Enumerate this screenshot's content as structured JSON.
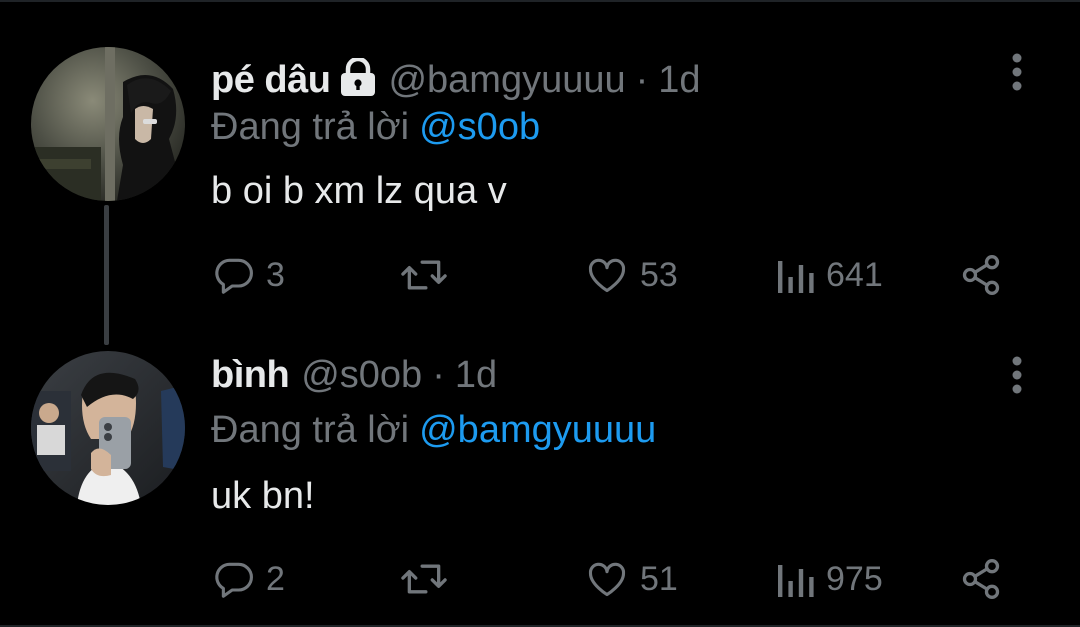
{
  "tweets": [
    {
      "display_name": "pé dâu",
      "protected": true,
      "handle": "@bamgyuuuu",
      "separator": "·",
      "time": "1d",
      "reply_prefix": "Đang trả lời",
      "reply_to": "@s0ob",
      "text": "b oi b xm lz qua v",
      "counts": {
        "replies": "3",
        "retweets": "",
        "likes": "53",
        "views": "641"
      }
    },
    {
      "display_name": "bình",
      "protected": false,
      "handle": "@s0ob",
      "separator": "·",
      "time": "1d",
      "reply_prefix": "Đang trả lời",
      "reply_to": "@bamgyuuuu",
      "text": "uk bn!",
      "counts": {
        "replies": "2",
        "retweets": "",
        "likes": "51",
        "views": "975"
      }
    }
  ],
  "icons": {
    "reply": "reply-icon",
    "retweet": "retweet-icon",
    "like": "heart-icon",
    "views": "views-icon",
    "share": "share-icon",
    "more": "more-vertical-icon",
    "lock": "lock-icon"
  },
  "colors": {
    "background": "#000000",
    "primary_text": "#e7e9ea",
    "secondary_text": "#71767b",
    "mention": "#1d9bf0",
    "thread_line": "#3a3e42"
  }
}
